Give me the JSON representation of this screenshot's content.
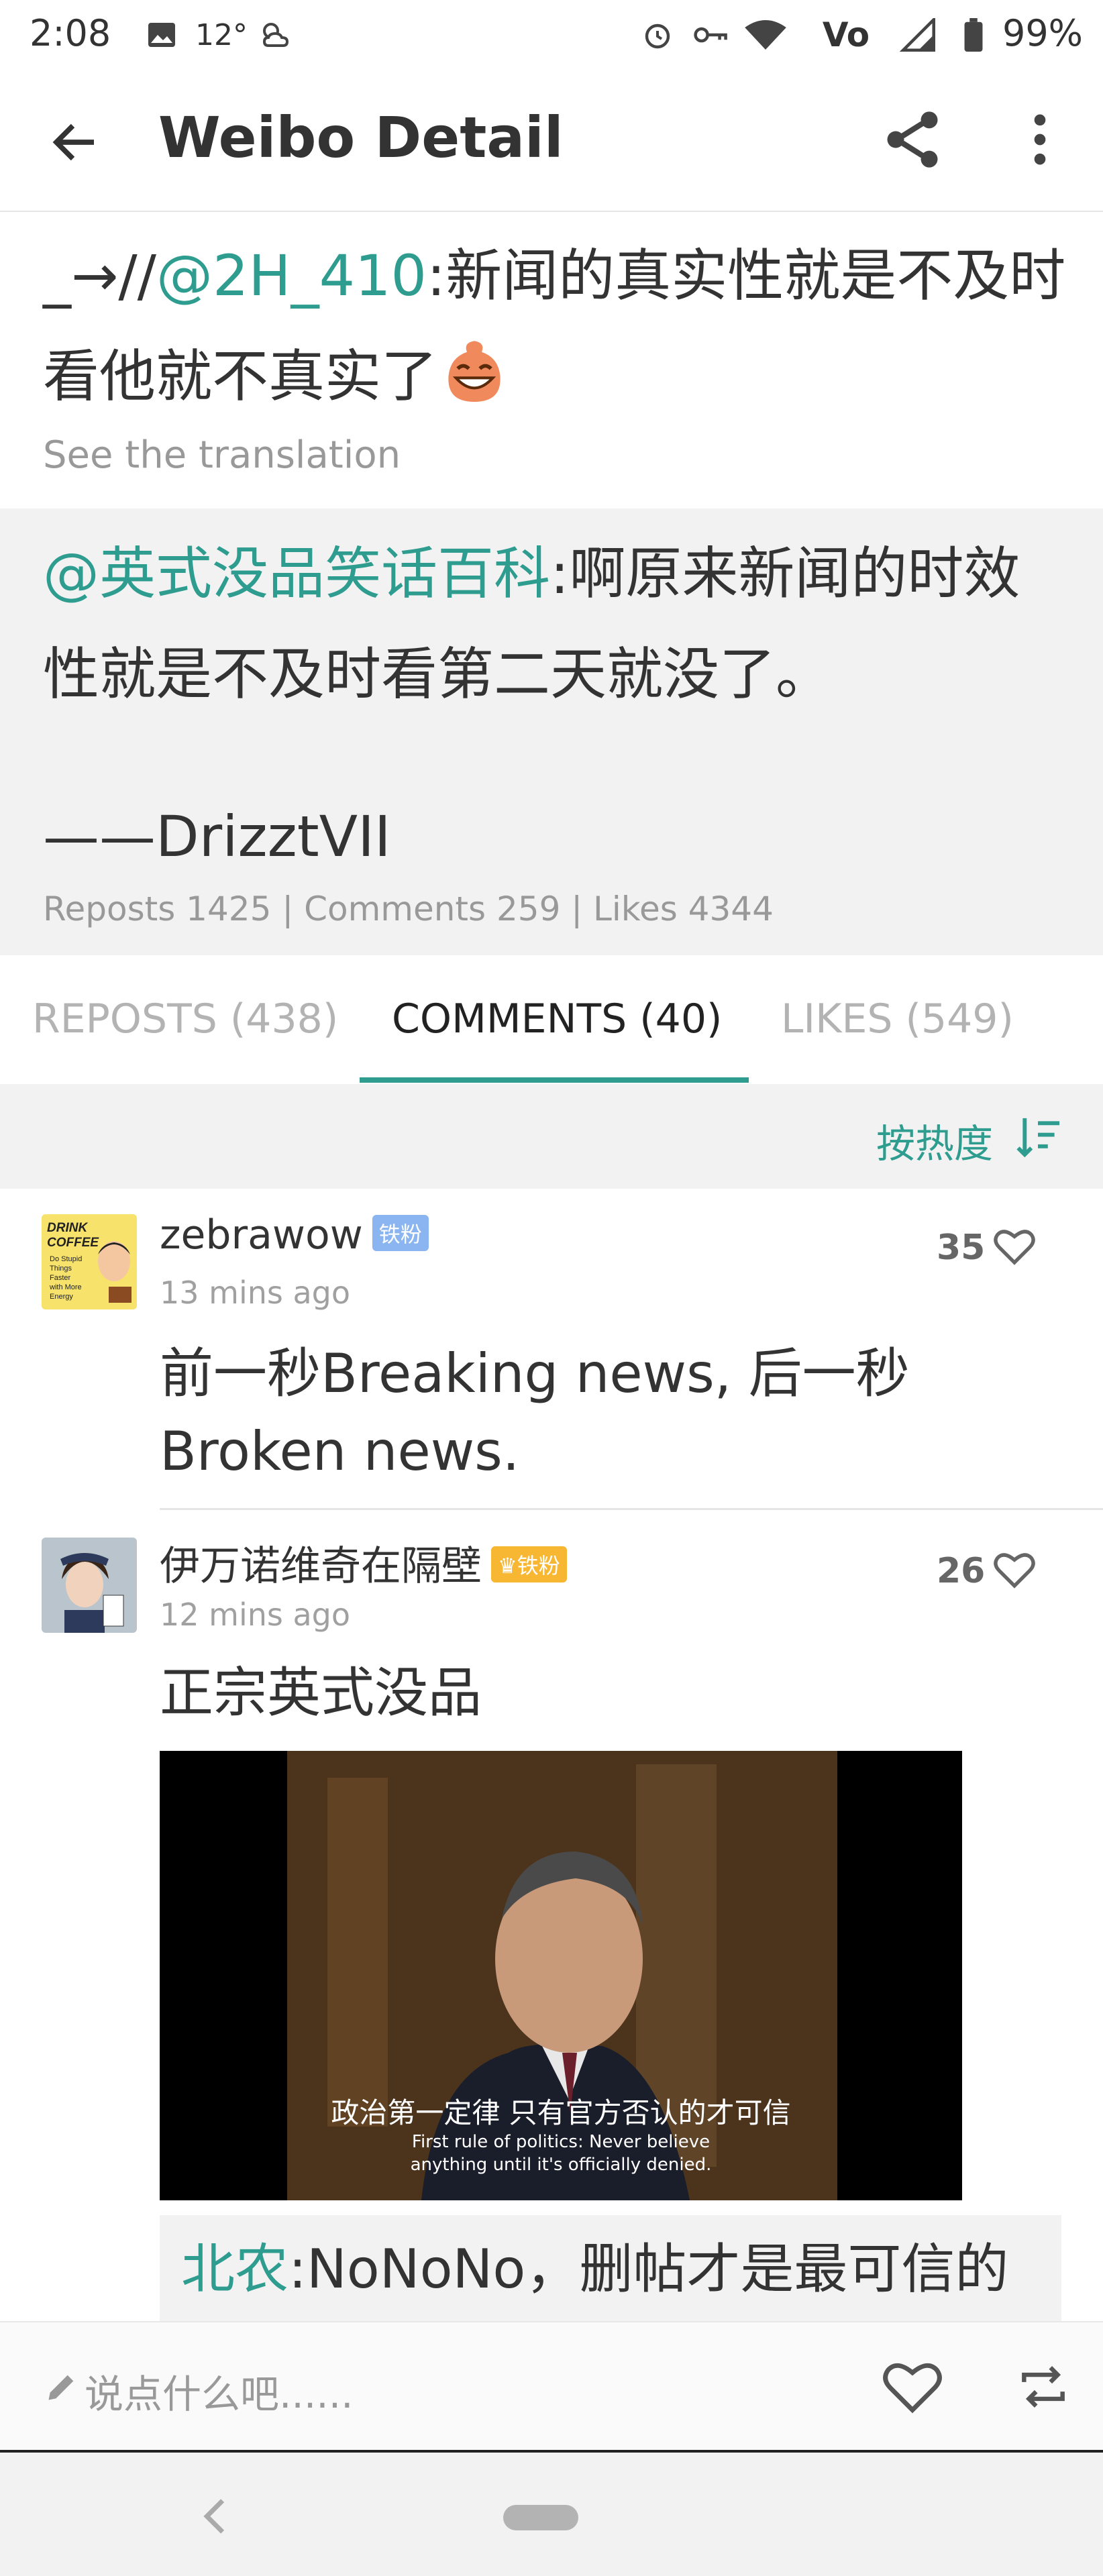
{
  "status_bar": {
    "time": "2:08",
    "temperature": "12°",
    "battery": "99%",
    "icons": [
      "image-icon",
      "cloudy-icon",
      "alarm-icon",
      "vpn-key-icon",
      "wifi-icon",
      "volte-icon",
      "signal-icon",
      "battery-icon"
    ]
  },
  "app_bar": {
    "title": "Weibo Detail",
    "icons": [
      "back-arrow-icon",
      "share-icon",
      "more-vert-icon"
    ]
  },
  "post": {
    "prefix": "_→//",
    "mention": "@2H_410",
    "body": ":新闻的真实性就是不及时看他就不真实了",
    "emoji": "laughing-face-icon",
    "translate": "See the translation"
  },
  "quote": {
    "mention": "@英式没品笑话百科",
    "body": ":啊原来新闻的时效性就是不及时看第二天就没了。",
    "signature": "——DrizztVII",
    "stats": "Reposts 1425 | Comments 259 | Likes 4344"
  },
  "tabs": [
    {
      "label": "REPOSTS (438)",
      "active": false
    },
    {
      "label": "COMMENTS (40)",
      "active": true
    },
    {
      "label": "LIKES (549)",
      "active": false
    }
  ],
  "sort": {
    "label": "按热度"
  },
  "comments": [
    {
      "name": "zebrawow",
      "badge": "铁粉",
      "time": "13 mins ago",
      "likes": "35",
      "text": "前一秒Breaking news, 后一秒Broken news.",
      "avatar_text": [
        "DRINK",
        "COFFEE",
        "Do Stupid",
        "Things",
        "Faster",
        "with More",
        "Energy"
      ]
    },
    {
      "name": "伊万诺维奇在隔壁",
      "badge": "铁粉",
      "time": "12 mins ago",
      "likes": "26",
      "text": "正宗英式没品",
      "video": {
        "subtitle_cn": "政治第一定律 只有官方否认的才可信",
        "subtitle_en_1": "First rule of politics: Never believe",
        "subtitle_en_2": "anything until it's officially denied."
      },
      "reply": {
        "mention": "北农",
        "body": ":NoNoNo，删帖才是最可信的"
      }
    }
  ],
  "input_bar": {
    "placeholder": "说点什么吧......"
  },
  "colors": {
    "accent": "#2e9d8f",
    "muted": "#999999",
    "panel": "#f2f2f2"
  }
}
